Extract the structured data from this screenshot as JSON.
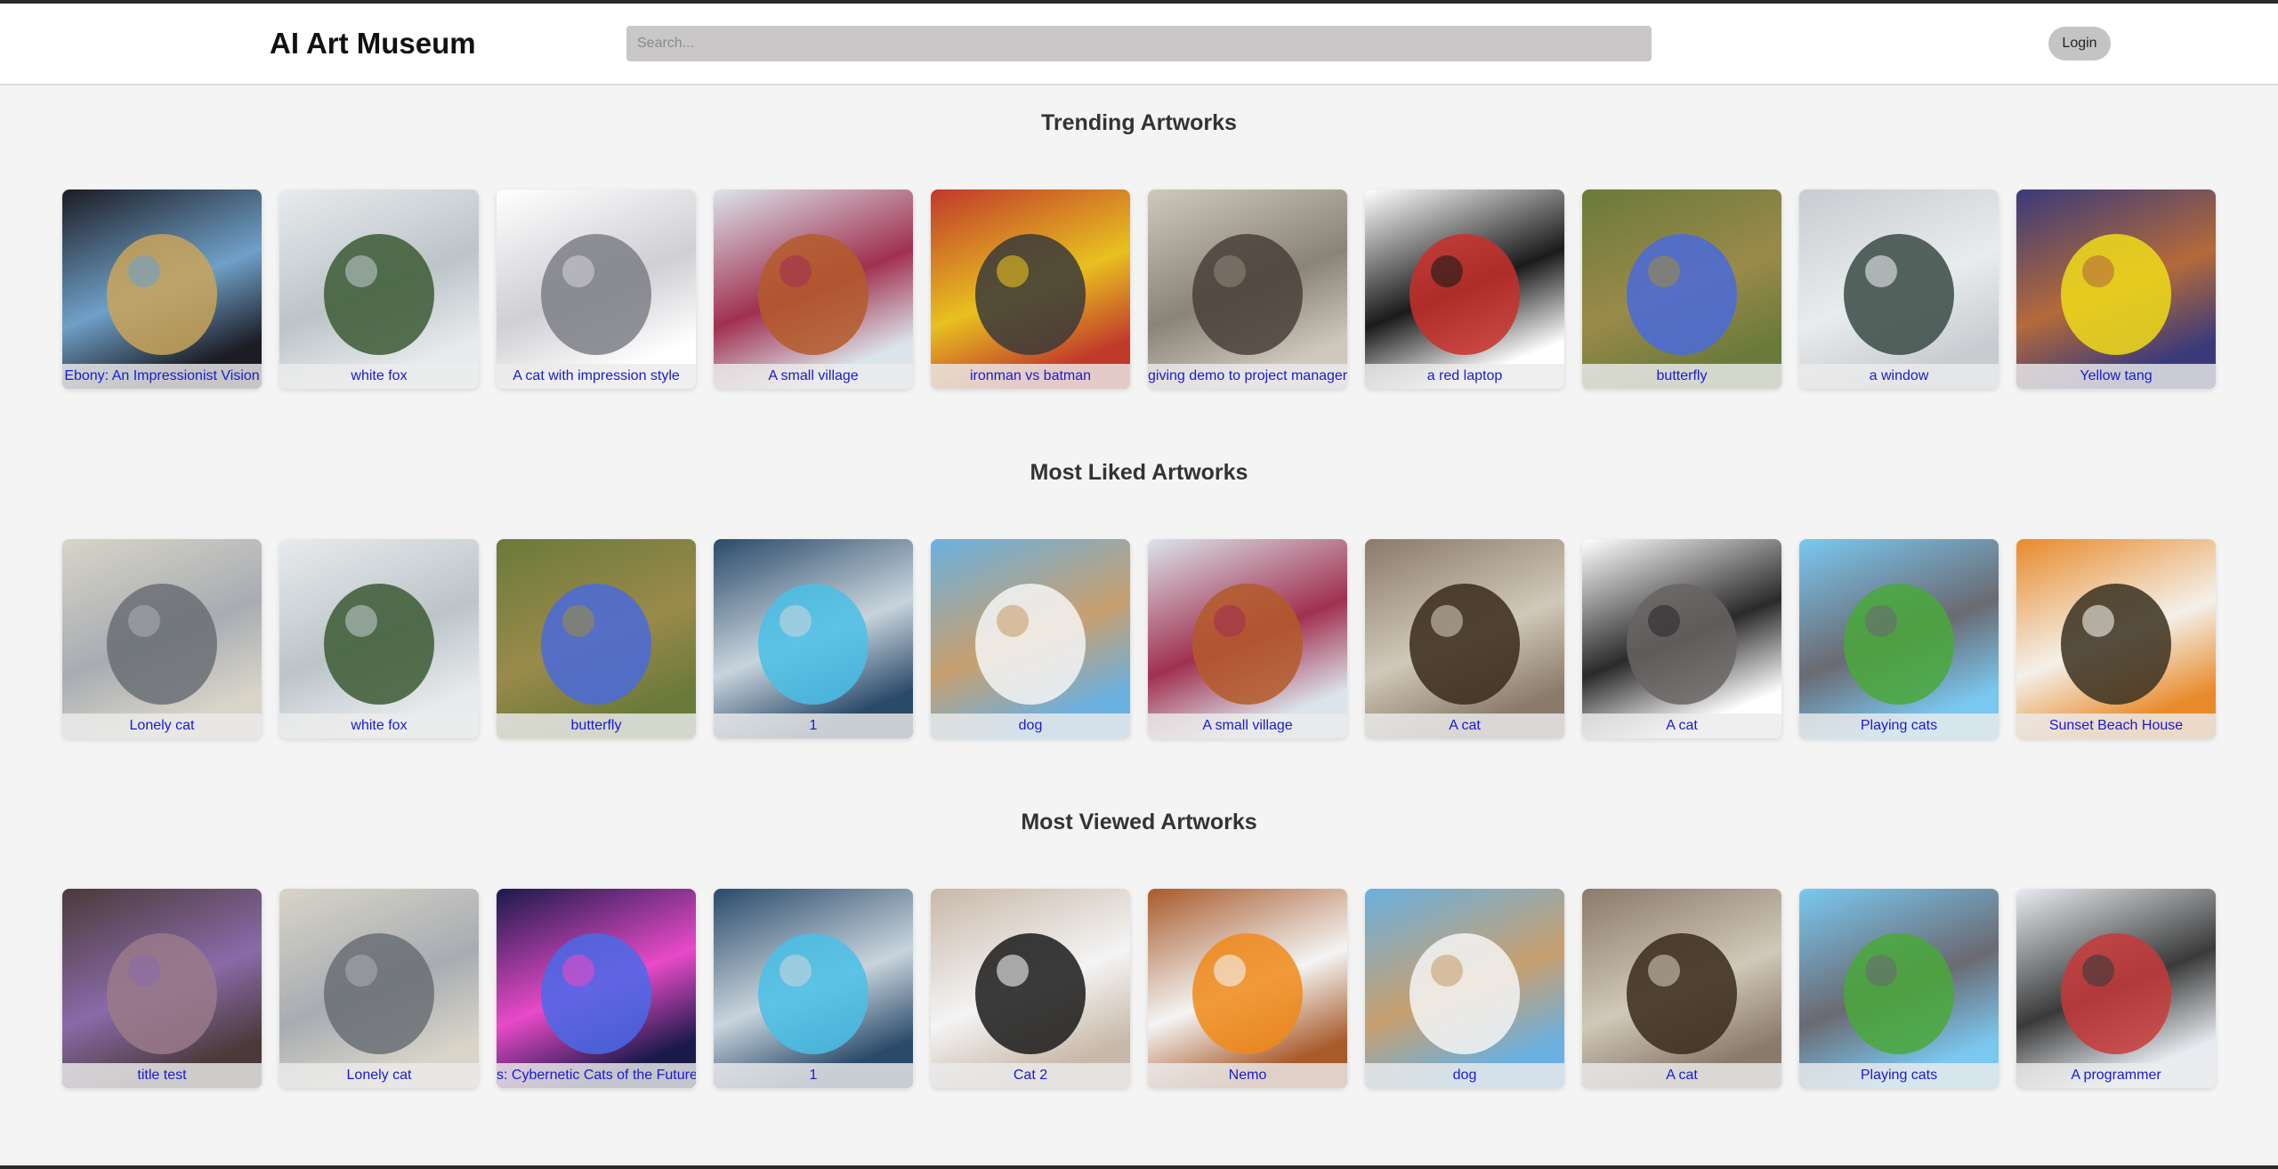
{
  "header": {
    "title": "AI Art Museum",
    "search_placeholder": "Search...",
    "login_label": "Login"
  },
  "sections": [
    {
      "title": "Trending Artworks",
      "items": [
        {
          "caption": "Ebony: An Impressionist Vision",
          "icon": "black-cat-art",
          "colors": [
            "#1c1c24",
            "#c9a45a",
            "#6fa0c8"
          ]
        },
        {
          "caption": "white fox",
          "icon": "white-fox-art",
          "colors": [
            "#e8ebee",
            "#3b5a34",
            "#bcc4c8"
          ]
        },
        {
          "caption": "A cat with impression style",
          "icon": "cat-impression-art",
          "colors": [
            "#ffffff",
            "#7e7e86",
            "#cfcfd4"
          ]
        },
        {
          "caption": "A small village",
          "icon": "village-art",
          "colors": [
            "#dbe4ea",
            "#b45a2a",
            "#a03050"
          ]
        },
        {
          "caption": "ironman vs batman",
          "icon": "superheroes-art",
          "colors": [
            "#c0392b",
            "#3a3a3a",
            "#e8c020"
          ]
        },
        {
          "caption": "giving demo to project manager",
          "icon": "office-demo-art",
          "colors": [
            "#cfc8bc",
            "#4a4038",
            "#8a8478"
          ]
        },
        {
          "caption": "a red laptop",
          "icon": "laptop-art",
          "colors": [
            "#ffffff",
            "#c8302a",
            "#1a1a1a"
          ]
        },
        {
          "caption": "butterfly",
          "icon": "butterfly-art",
          "colors": [
            "#6a7a3a",
            "#4a6adc",
            "#9a8a4a"
          ]
        },
        {
          "caption": "a window",
          "icon": "window-art",
          "colors": [
            "#c8ccd0",
            "#3a4a44",
            "#e8ecee"
          ]
        },
        {
          "caption": "Yellow tang",
          "icon": "fish-art",
          "colors": [
            "#3a3a7a",
            "#f0dc1a",
            "#b46a3a"
          ]
        }
      ]
    },
    {
      "title": "Most Liked Artworks",
      "items": [
        {
          "caption": "Lonely cat",
          "icon": "grey-kitten-art",
          "colors": [
            "#d8d4c8",
            "#6a6e74",
            "#a8acb2"
          ]
        },
        {
          "caption": "white fox",
          "icon": "white-fox-art",
          "colors": [
            "#e8ebee",
            "#3b5a34",
            "#bcc4c8"
          ]
        },
        {
          "caption": "butterfly",
          "icon": "butterfly-art",
          "colors": [
            "#6a7a3a",
            "#4a6adc",
            "#9a8a4a"
          ]
        },
        {
          "caption": "1",
          "icon": "cyber-cats-art",
          "colors": [
            "#2a4a6a",
            "#4ac0e8",
            "#c8d4dc"
          ]
        },
        {
          "caption": "dog",
          "icon": "dog-art",
          "colors": [
            "#6ab0e0",
            "#f4f4f4",
            "#c8a070"
          ]
        },
        {
          "caption": "A small village",
          "icon": "village-art",
          "colors": [
            "#dbe4ea",
            "#b45a2a",
            "#a03050"
          ]
        },
        {
          "caption": "A cat",
          "icon": "painted-cat-art",
          "colors": [
            "#8a7a6a",
            "#3a2a1a",
            "#d0c8b8"
          ]
        },
        {
          "caption": "A cat",
          "icon": "cartoon-cat-art",
          "colors": [
            "#ffffff",
            "#6a6464",
            "#2a2a2a"
          ]
        },
        {
          "caption": "Playing cats",
          "icon": "playing-cats-art",
          "colors": [
            "#7ac8f0",
            "#4aa83a",
            "#6a6a72"
          ]
        },
        {
          "caption": "Sunset Beach House",
          "icon": "beach-house-art",
          "colors": [
            "#e88a2a",
            "#3a3020",
            "#f4f0ea"
          ]
        }
      ]
    },
    {
      "title": "Most Viewed Artworks",
      "items": [
        {
          "caption": "title test",
          "icon": "elephants-art",
          "colors": [
            "#4a3a3a",
            "#9a7a8a",
            "#8a6aa8"
          ]
        },
        {
          "caption": "Lonely cat",
          "icon": "grey-kitten-art",
          "colors": [
            "#d8d4c8",
            "#6a6e74",
            "#a8acb2"
          ]
        },
        {
          "caption": "s: Cybernetic Cats of the Future",
          "icon": "cybernetic-cat-art",
          "colors": [
            "#1a1a4a",
            "#4a6ae8",
            "#e84ac8"
          ]
        },
        {
          "caption": "1",
          "icon": "cyber-cats-art",
          "colors": [
            "#2a4a6a",
            "#4ac0e8",
            "#c8d4dc"
          ]
        },
        {
          "caption": "Cat 2",
          "icon": "tuxedo-cat-art",
          "colors": [
            "#c8b8a8",
            "#1a1a1a",
            "#f4f4f4"
          ]
        },
        {
          "caption": "Nemo",
          "icon": "clownfish-art",
          "colors": [
            "#a85a2a",
            "#f08a1a",
            "#f4f4f4"
          ]
        },
        {
          "caption": "dog",
          "icon": "dog-art",
          "colors": [
            "#6ab0e0",
            "#f4f4f4",
            "#c8a070"
          ]
        },
        {
          "caption": "A cat",
          "icon": "painted-cat-art",
          "colors": [
            "#8a7a6a",
            "#3a2a1a",
            "#d0c8b8"
          ]
        },
        {
          "caption": "Playing cats",
          "icon": "playing-cats-art",
          "colors": [
            "#7ac8f0",
            "#4aa83a",
            "#6a6a72"
          ]
        },
        {
          "caption": "A programmer",
          "icon": "programmer-art",
          "colors": [
            "#e8ecf0",
            "#c83a3a",
            "#3a3a3a"
          ]
        }
      ]
    }
  ]
}
